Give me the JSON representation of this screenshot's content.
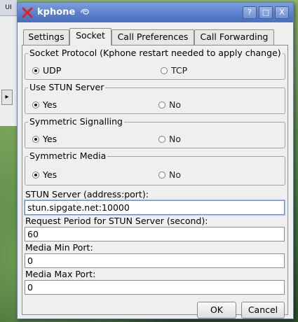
{
  "background": {
    "tab_label": "UI",
    "scroll_glyph": "▸"
  },
  "window": {
    "title": "kphone",
    "buttons": {
      "help": "?",
      "maximize": "□",
      "close": "X"
    }
  },
  "tabs": [
    {
      "label": "Settings",
      "active": false
    },
    {
      "label": "Socket",
      "active": true
    },
    {
      "label": "Call Preferences",
      "active": false
    },
    {
      "label": "Call Forwarding",
      "active": false
    }
  ],
  "groups": {
    "socket_protocol": {
      "title": "Socket Protocol (Kphone restart needed to apply change)",
      "options": [
        {
          "label": "UDP",
          "selected": true
        },
        {
          "label": "TCP",
          "selected": false
        }
      ]
    },
    "use_stun": {
      "title": "Use STUN Server",
      "options": [
        {
          "label": "Yes",
          "selected": true
        },
        {
          "label": "No",
          "selected": false
        }
      ]
    },
    "symmetric_signalling": {
      "title": "Symmetric Signalling",
      "options": [
        {
          "label": "Yes",
          "selected": true
        },
        {
          "label": "No",
          "selected": false
        }
      ]
    },
    "symmetric_media": {
      "title": "Symmetric Media",
      "options": [
        {
          "label": "Yes",
          "selected": true
        },
        {
          "label": "No",
          "selected": false
        }
      ]
    }
  },
  "fields": {
    "stun_server": {
      "label": "STUN Server (address:port):",
      "value": "stun.sipgate.net:10000"
    },
    "request_period": {
      "label": "Request Period for STUN Server (second):",
      "value": "60"
    },
    "media_min_port": {
      "label": "Media Min Port:",
      "value": "0"
    },
    "media_max_port": {
      "label": "Media Max Port:",
      "value": "0"
    }
  },
  "actions": {
    "ok": "OK",
    "cancel": "Cancel"
  }
}
